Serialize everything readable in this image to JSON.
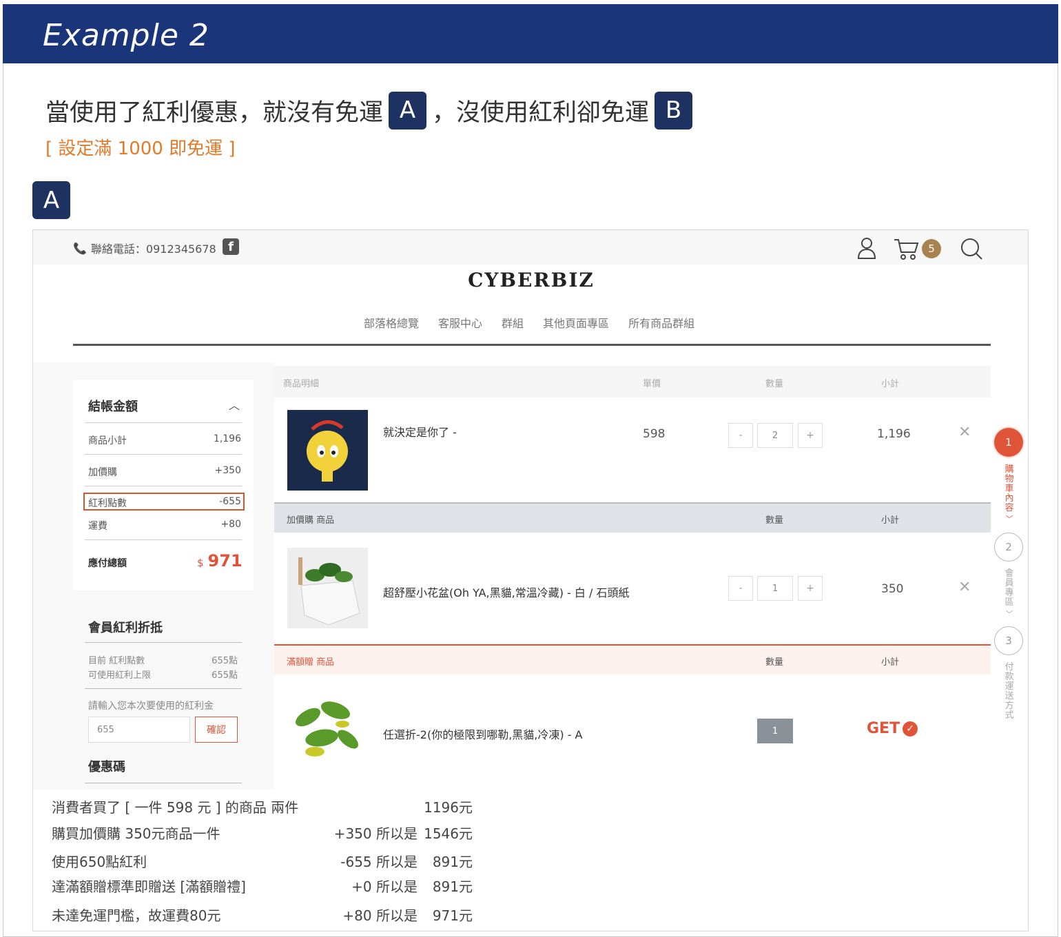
{
  "banner": {
    "title": "Example 2"
  },
  "headline": {
    "part1": "當使用了紅利優惠，就沒有免運",
    "badge_a": "A",
    "part2": "，沒使用紅利卻免運",
    "badge_b": "B",
    "sub": "[ 設定滿 1000 即免運 ]"
  },
  "section_badge": "A",
  "site": {
    "phone_label": "聯絡電話：0912345678",
    "cart_count": "5",
    "logo": "CYBERBIZ",
    "nav": [
      "部落格總覽",
      "客服中心",
      "群組",
      "其他頁面專區",
      "所有商品群組"
    ]
  },
  "summary": {
    "title": "結帳金額",
    "rows": [
      {
        "label": "商品小計",
        "value": "1,196"
      },
      {
        "label": "加價購",
        "value": "+350"
      },
      {
        "label": "紅利點數",
        "value": "-655"
      },
      {
        "label": "運費",
        "value": "+80"
      }
    ],
    "total_label": "應付總額",
    "currency": "$",
    "total": "971"
  },
  "bonus": {
    "title": "會員紅利折抵",
    "current_label": "目前 紅利點數",
    "current_value": "655點",
    "limit_label": "可使用紅利上限",
    "limit_value": "655點",
    "prompt": "請輸入您本次要使用的紅利金",
    "input_value": "655",
    "confirm": "確認"
  },
  "coupon": {
    "title": "優惠碼"
  },
  "cart": {
    "headers": {
      "detail": "商品明細",
      "unit": "單價",
      "qty": "數量",
      "subtotal": "小計"
    },
    "items": [
      {
        "name": "就決定是你了 -",
        "unit_price": "598",
        "qty": "2",
        "subtotal": "1,196"
      }
    ],
    "addon_header": {
      "label": "加價購 商品",
      "qty": "數量",
      "subtotal": "小計"
    },
    "addon_items": [
      {
        "name": "超舒壓小花盆(Oh YA,黑貓,常溫冷藏) - 白 / 石頭紙",
        "qty": "1",
        "subtotal": "350"
      }
    ],
    "gift_header": {
      "label": "滿額贈 商品",
      "qty": "數量",
      "subtotal": "小計"
    },
    "gift_items": [
      {
        "name": "任選折-2(你的極限到哪勒,黑貓,冷凍) - A",
        "qty": "1",
        "status": "GET"
      }
    ],
    "minus": "-",
    "plus": "+"
  },
  "steps": [
    {
      "num": "1",
      "label": "購物車內容"
    },
    {
      "num": "2",
      "label": "會員專區"
    },
    {
      "num": "3",
      "label": "付款運送方式"
    }
  ],
  "calculation": [
    {
      "desc": "消費者買了 [ 一件 598 元 ] 的商品 兩件",
      "op": "",
      "result": "1196元"
    },
    {
      "desc": "購買加價購 350元商品一件",
      "op": "+350 所以是",
      "result": "1546元"
    },
    {
      "desc": "使用650點紅利",
      "op": "-655 所以是",
      "result": "891元"
    },
    {
      "desc": "達滿額贈標準即贈送 [滿額贈禮]",
      "op": "+0  所以是",
      "result": "891元"
    },
    {
      "desc": "未達免運門檻，故運費80元",
      "op": "+80  所以是",
      "result": "971元"
    }
  ],
  "colors": {
    "banner": "#1b357a",
    "badge": "#1e3262",
    "accent_orange": "#e07b2b",
    "price_red": "#e0543a",
    "cart_badge": "#a8834f"
  }
}
